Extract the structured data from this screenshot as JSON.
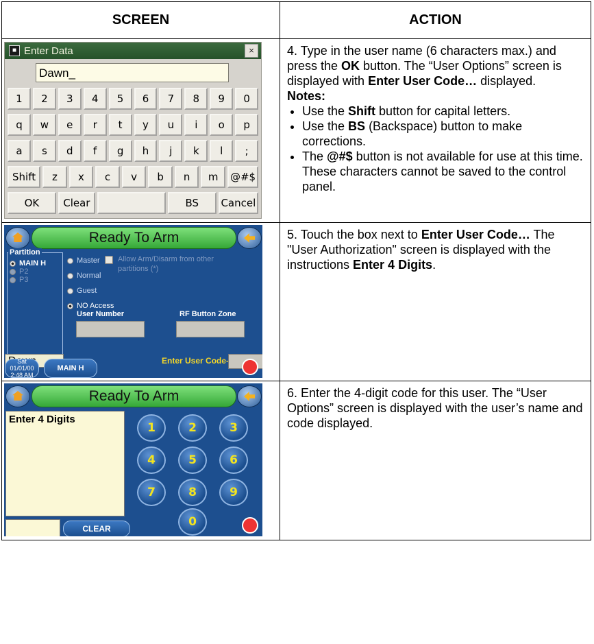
{
  "header": {
    "screen": "SCREEN",
    "action": "ACTION"
  },
  "kb": {
    "title": "Enter Data",
    "close": "×",
    "value": "Dawn_",
    "rows": [
      [
        "1",
        "2",
        "3",
        "4",
        "5",
        "6",
        "7",
        "8",
        "9",
        "0"
      ],
      [
        "q",
        "w",
        "e",
        "r",
        "t",
        "y",
        "u",
        "i",
        "o",
        "p"
      ],
      [
        "a",
        "s",
        "d",
        "f",
        "g",
        "h",
        "j",
        "k",
        "l",
        ";"
      ],
      [
        "Shift",
        "z",
        "x",
        "c",
        "v",
        "b",
        "n",
        "m",
        "@#$"
      ],
      [
        "OK",
        "Clear",
        "",
        "BS",
        "Cancel"
      ]
    ]
  },
  "row1": {
    "p1a": "4.  Type in the user name (6 characters max.) and press the ",
    "p1b": "OK",
    "p1c": " button.  The “User Options” screen is displayed with ",
    "p1d": "Enter User Code…",
    "p1e": " displayed.",
    "notes": "Notes:",
    "b1a": "Use the ",
    "b1b": "Shift",
    "b1c": " button for capital letters.",
    "b2a": "Use the ",
    "b2b": "BS",
    "b2c": " (Backspace) button to make corrections.",
    "b3a": "The ",
    "b3b": "@#$",
    "b3c": " button is not available for use at this time. These characters cannot be saved to the control panel."
  },
  "screen2": {
    "title": "Ready To Arm",
    "partition": "Partition",
    "parts": [
      "MAIN H",
      "P2",
      "P3"
    ],
    "roles": [
      "Master",
      "Normal",
      "Guest",
      "NO Access"
    ],
    "allow": "Allow Arm/Disarm from other partitions (*)",
    "user_number": "User Number",
    "rf_zone": "RF Button Zone",
    "name": "Dawn",
    "enter_code": "Enter User Code-->",
    "date": "Sat 01/01/00",
    "time": "2:48 AM",
    "main": "MAIN H"
  },
  "row2": {
    "a": "5.  Touch the box next to ",
    "b": "Enter User Code…",
    "c": "  The \"User Authorization\" screen is displayed with the instructions ",
    "d": "Enter 4 Digits",
    "e": "."
  },
  "screen3": {
    "title": "Ready To Arm",
    "prompt": "Enter 4 Digits",
    "digits": [
      "1",
      "2",
      "3",
      "4",
      "5",
      "6",
      "7",
      "8",
      "9",
      "0"
    ],
    "clear": "CLEAR"
  },
  "row3": {
    "text": "6.  Enter the 4-digit code for this user.  The “User Options” screen is displayed with the user’s name and code displayed."
  },
  "colors": {
    "panel_blue": "#1d4f8f",
    "title_green": "#4cc04c",
    "digit_yellow": "#f3e41f"
  }
}
